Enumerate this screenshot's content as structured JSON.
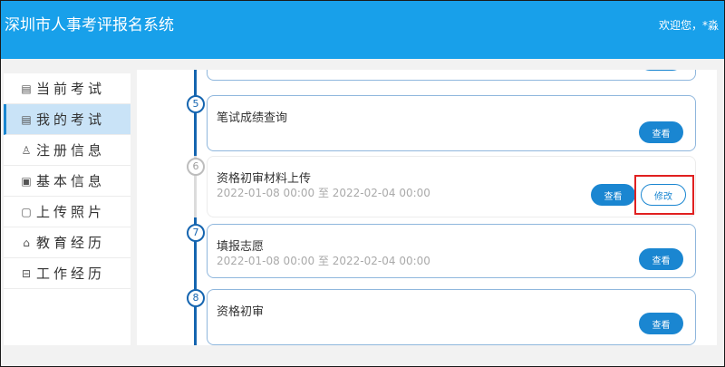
{
  "header": {
    "title": "深圳市人事考评报名系统",
    "welcome": "欢迎您，*淼"
  },
  "sidebar": {
    "items": [
      {
        "label": "当前考试",
        "icon": "document-icon",
        "active": false
      },
      {
        "label": "我的考试",
        "icon": "document-icon",
        "active": true
      },
      {
        "label": "注册信息",
        "icon": "user-icon",
        "active": false
      },
      {
        "label": "基本信息",
        "icon": "id-card-icon",
        "active": false
      },
      {
        "label": "上传照片",
        "icon": "photo-icon",
        "active": false
      },
      {
        "label": "教育经历",
        "icon": "graduation-cap-icon",
        "active": false
      },
      {
        "label": "工作经历",
        "icon": "briefcase-icon",
        "active": false
      }
    ]
  },
  "steps": [
    {
      "num": "5",
      "title": "笔试成绩查询",
      "date": "",
      "view_label": "查看"
    },
    {
      "num": "6",
      "title": "资格初审材料上传",
      "date": "2022-01-08 00:00 至 2022-02-04 00:00",
      "view_label": "查看",
      "edit_label": "修改"
    },
    {
      "num": "7",
      "title": "填报志愿",
      "date": "2022-01-08 00:00 至 2022-02-04 00:00",
      "view_label": "查看"
    },
    {
      "num": "8",
      "title": "资格初审",
      "date": "",
      "view_label": "查看"
    }
  ],
  "colors": {
    "header_bg": "#18a0ea",
    "primary": "#1a86d1",
    "timeline": "#1565b0",
    "highlight": "#e02020"
  }
}
